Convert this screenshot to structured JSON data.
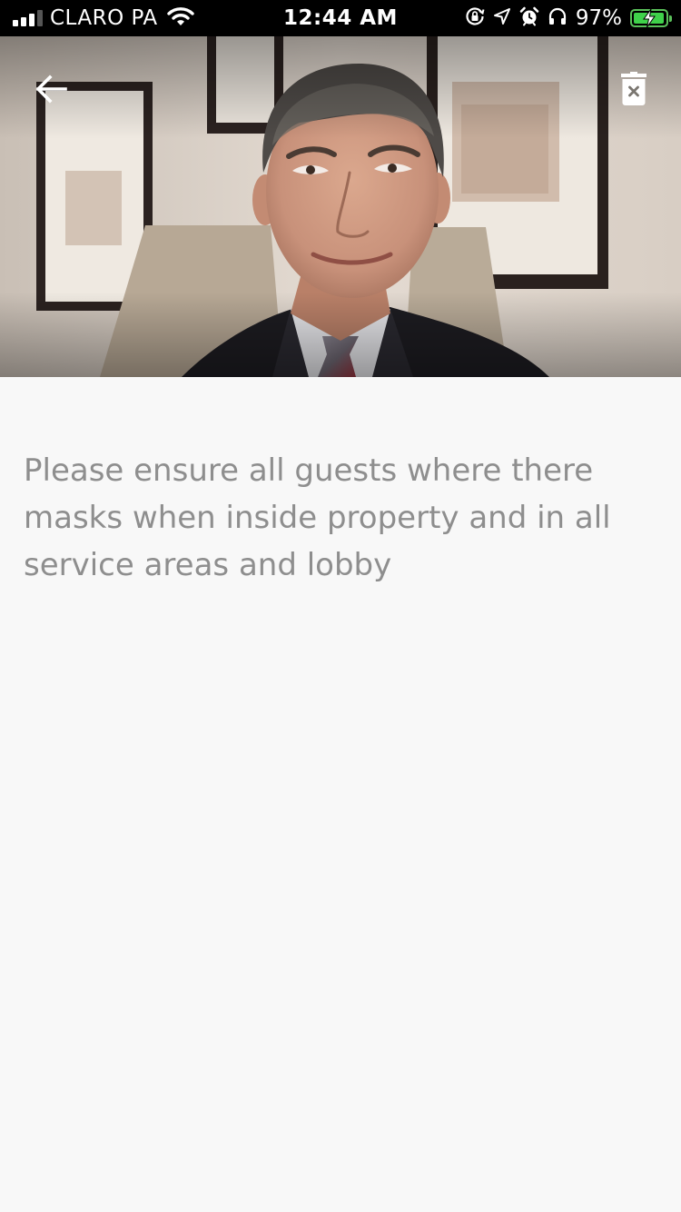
{
  "status_bar": {
    "carrier": "CLARO PA",
    "time": "12:44 AM",
    "battery_percent": "97%",
    "battery_level": 0.97,
    "battery_color": "#3fd14a",
    "signal_bars_active": 3,
    "signal_bars_total": 4,
    "icons": [
      "signal-icon",
      "wifi-icon",
      "orientation-lock-icon",
      "location-icon",
      "alarm-icon",
      "headphones-icon",
      "battery-charging-icon"
    ]
  },
  "header": {
    "back_icon": "arrow-left-icon",
    "delete_icon": "trash-x-icon",
    "photo": "man-in-suit-portrait"
  },
  "message": {
    "body": "Please ensure all guests where there masks when inside property and in all service areas and lobby",
    "text_color": "#8e8e8e"
  },
  "colors": {
    "background": "#f8f8f8",
    "status_bar": "#000000"
  }
}
